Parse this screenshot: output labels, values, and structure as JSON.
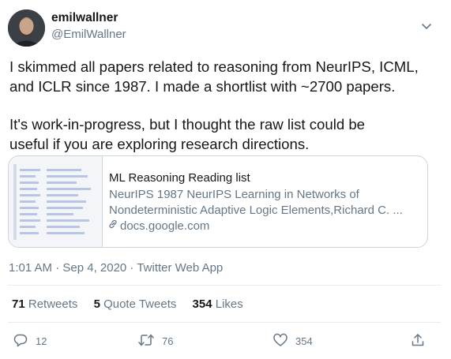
{
  "tweet": {
    "display_name": "emilwallner",
    "handle": "@EmilWallner",
    "text_lines": [
      "I skimmed all papers related to reasoning from NeurIPS, ICML,",
      "and ICLR since 1987. I made a shortlist with ~2700 papers.",
      "It's work-in-progress, but I thought the raw list could be",
      "useful if you are exploring research directions."
    ],
    "card": {
      "title": "ML Reasoning Reading list",
      "description_lines": [
        "NeurIPS 1987 NeurIPS Learning in Networks of",
        "Nondeterministic Adaptive Logic Elements,Richard C. ..."
      ],
      "domain": "docs.google.com"
    },
    "meta": "1:01 AM · Sep 4, 2020 · Twitter Web App",
    "stats": {
      "retweets_count": "71",
      "retweets_label": "Retweets",
      "quotes_count": "5",
      "quotes_label": "Quote Tweets",
      "likes_count": "354",
      "likes_label": "Likes"
    },
    "actions": {
      "reply_count": "12",
      "retweet_count": "76",
      "like_count": "354"
    }
  },
  "icons": {
    "caret": "chevron-down-icon",
    "reply": "reply-icon",
    "retweet": "retweet-icon",
    "like": "heart-icon",
    "share": "share-icon",
    "link": "link-icon"
  },
  "colors": {
    "text": "#14171a",
    "secondary": "#657786",
    "border": "#ccd6dd"
  }
}
